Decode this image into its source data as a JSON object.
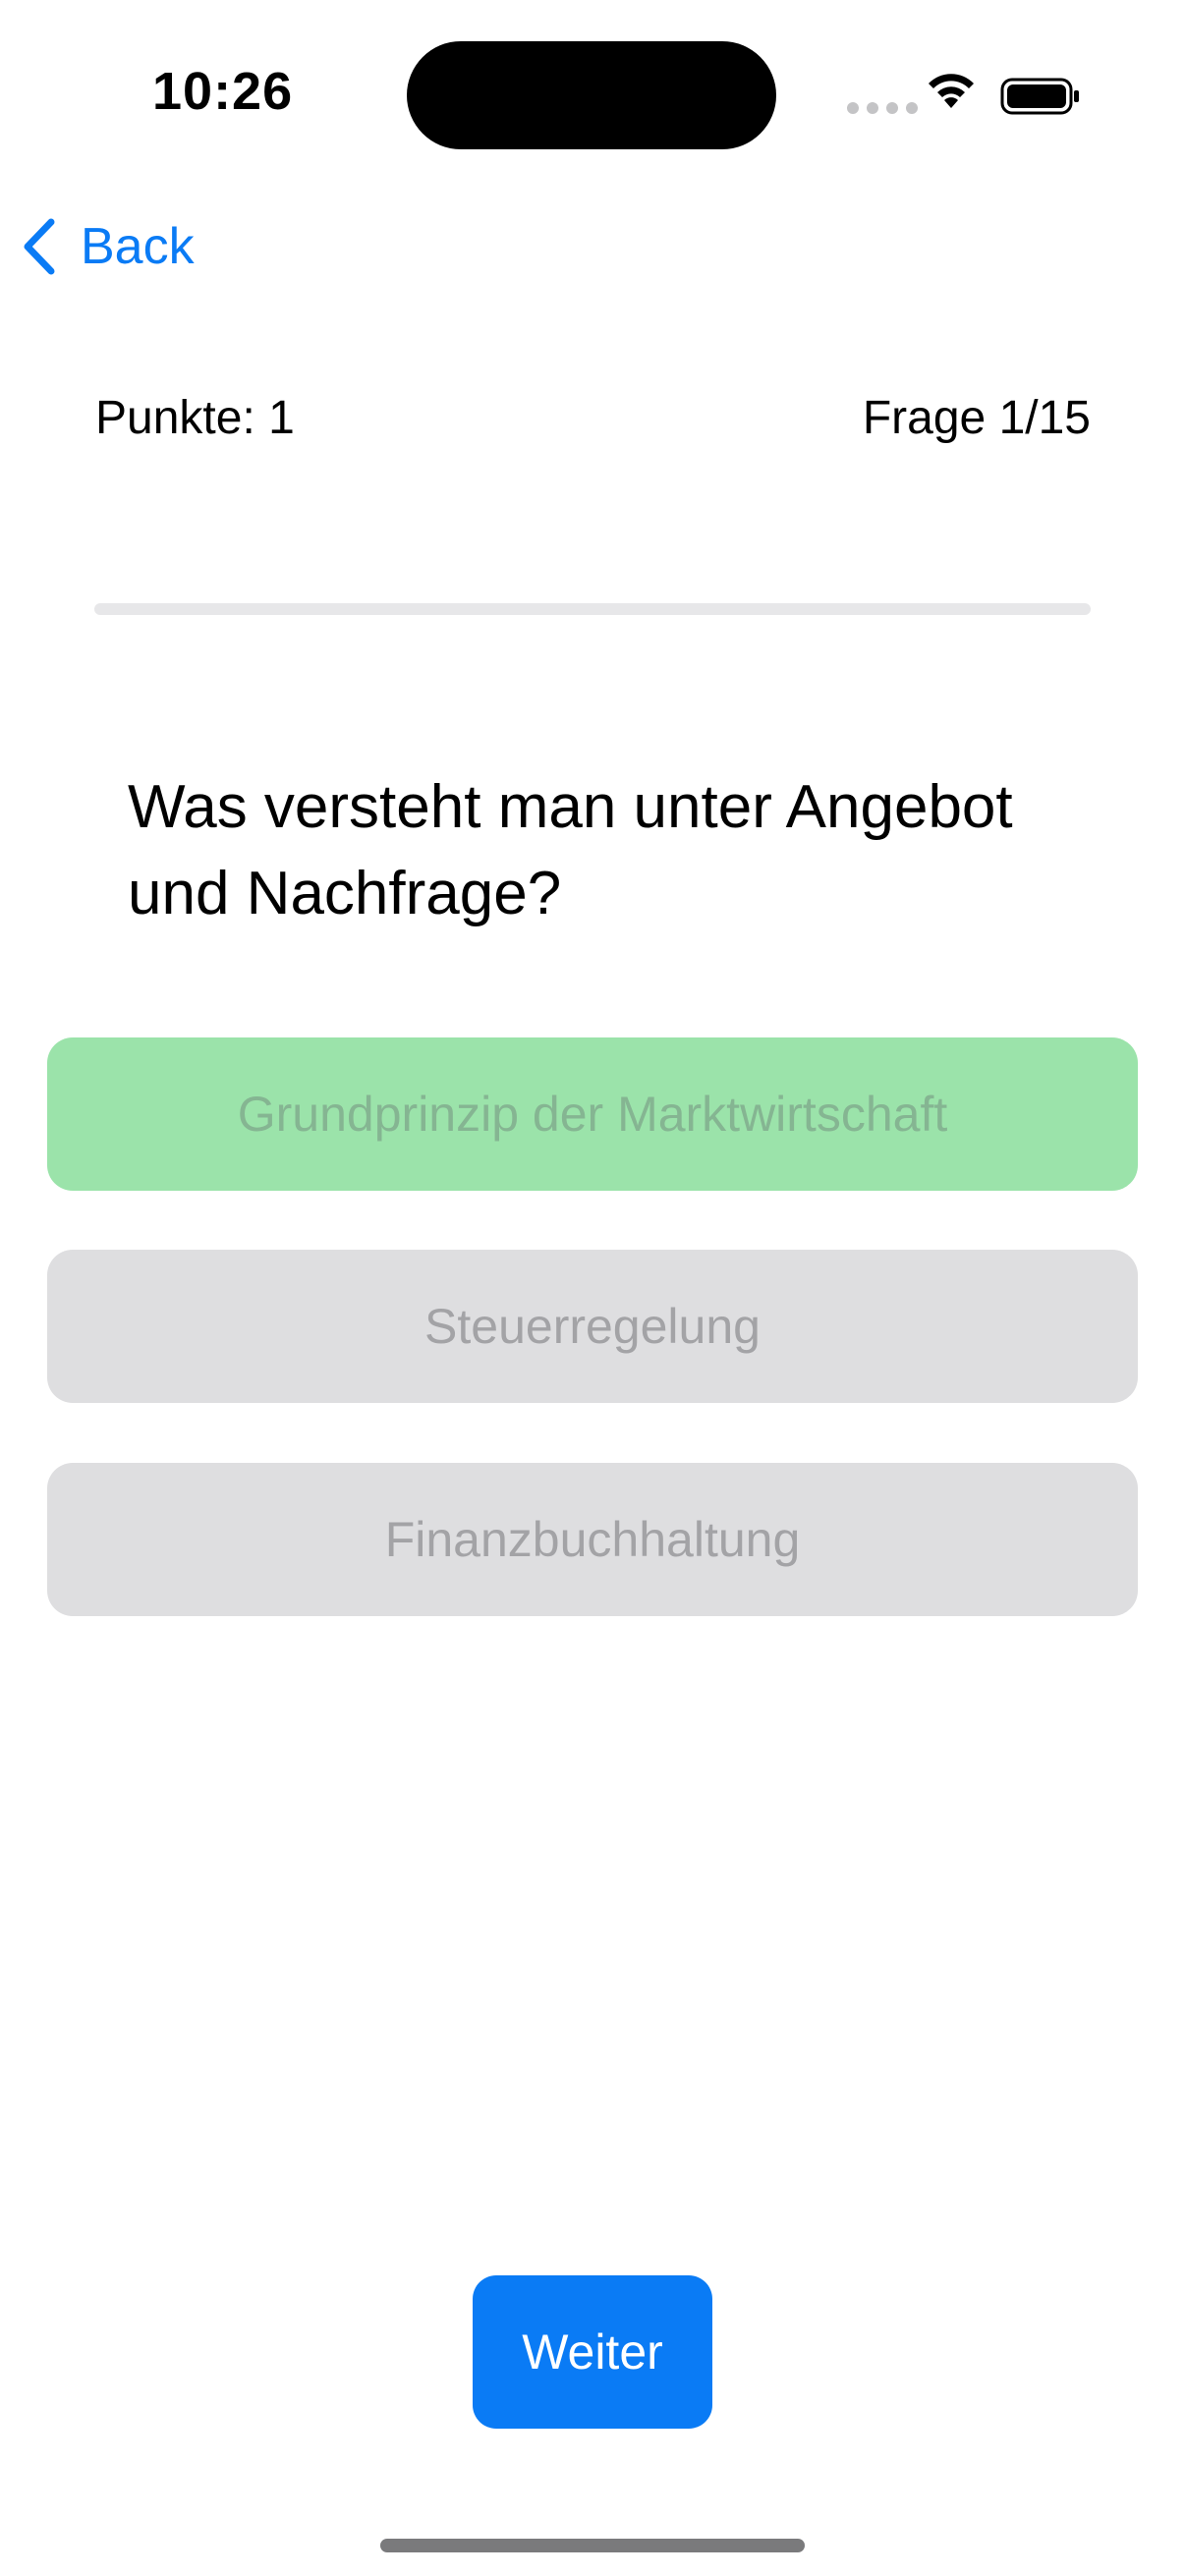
{
  "status_bar": {
    "time": "10:26"
  },
  "nav": {
    "back_label": "Back"
  },
  "quiz": {
    "score_label": "Punkte: 1",
    "question_counter": "Frage 1/15",
    "progress_fraction": 0,
    "question": "Was versteht man unter Angebot und Nachfrage?",
    "answers": [
      {
        "label": "Grundprinzip der Marktwirtschaft",
        "state": "correct"
      },
      {
        "label": "Steuerregelung",
        "state": "neutral"
      },
      {
        "label": "Finanzbuchhaltung",
        "state": "neutral"
      }
    ],
    "next_label": "Weiter"
  },
  "colors": {
    "accent": "#0a7bf5",
    "correct_bg": "#9be3aa",
    "neutral_bg": "#dedee0",
    "progress_track": "#e7e7e9"
  }
}
